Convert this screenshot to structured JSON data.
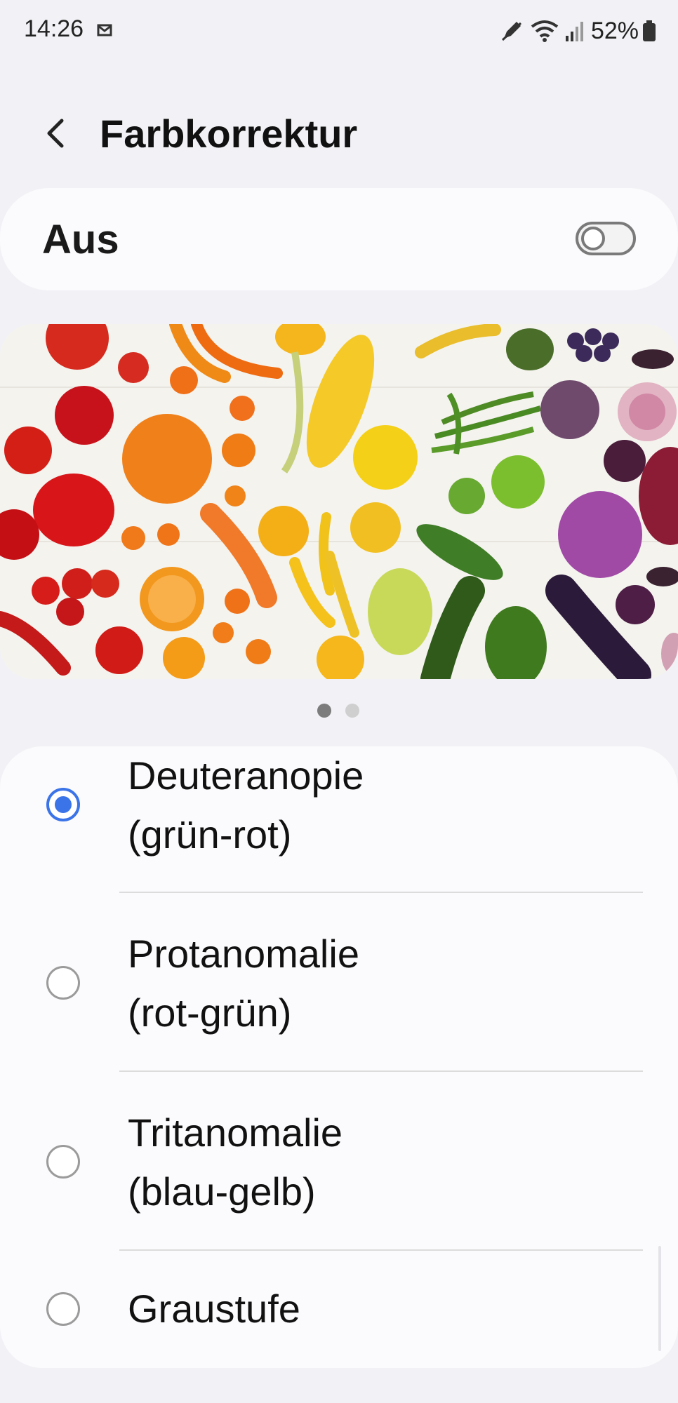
{
  "status_bar": {
    "time": "14:26",
    "battery": "52%",
    "icons": [
      "mail-icon",
      "pen-icon",
      "wifi-icon",
      "signal-icon",
      "battery-icon"
    ]
  },
  "header": {
    "back_icon": "chevron-left-icon",
    "title": "Farbkorrektur"
  },
  "master": {
    "label": "Aus",
    "enabled": false
  },
  "preview": {
    "image": "rainbow-vegetables-photo",
    "pages": 2,
    "active_page": 1
  },
  "options": [
    {
      "line1": "Deuteranopie",
      "line2": "(grün-rot)",
      "selected": true
    },
    {
      "line1": "Protanomalie",
      "line2": "(rot-grün)",
      "selected": false
    },
    {
      "line1": "Tritanomalie",
      "line2": "(blau-gelb)",
      "selected": false
    },
    {
      "line1": "Graustufe",
      "line2": "",
      "selected": false
    }
  ],
  "colors": {
    "accent": "#3b74e8",
    "background": "#f2f2f6",
    "card": "#fbfbfd"
  }
}
